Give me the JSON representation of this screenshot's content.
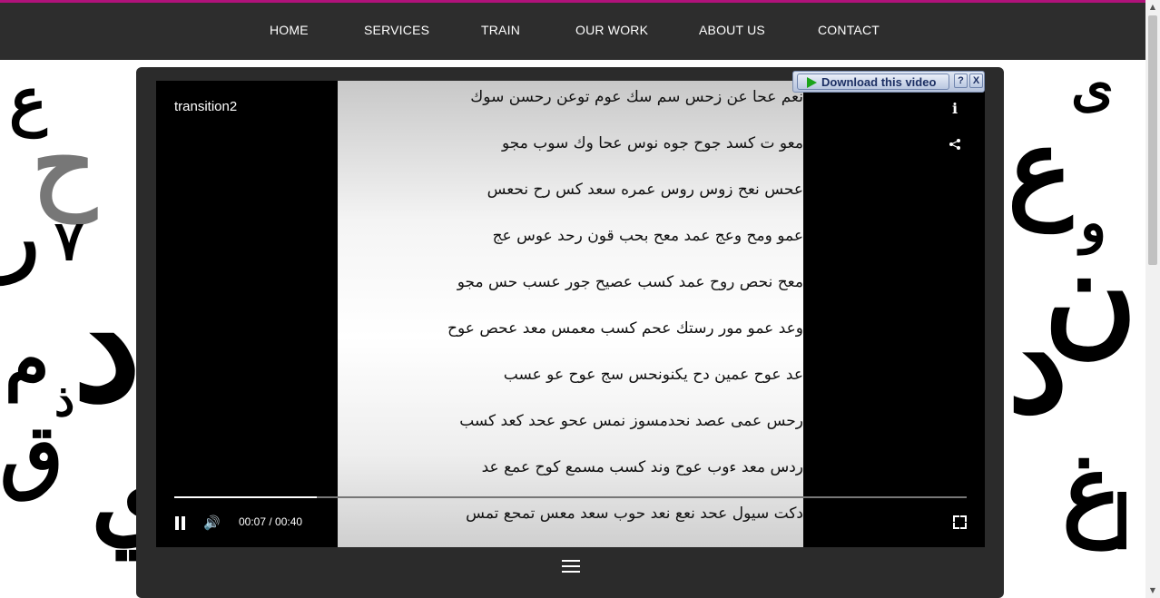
{
  "nav": {
    "items": [
      "HOME",
      "SERVICES",
      "TRAIN",
      "OUR WORK",
      "ABOUT US",
      "CONTACT"
    ]
  },
  "colors": {
    "accent": "#b0127a",
    "topbar": "#2d2d2d",
    "player_frame": "#2b2b2b"
  },
  "player": {
    "title": "transition2",
    "time_display": "00:07 / 00:40",
    "progress": 0.18,
    "icons": [
      "info-icon",
      "share-icon",
      "pause-icon",
      "volume-icon",
      "fullscreen-icon",
      "menu-icon"
    ]
  },
  "download_bar": {
    "label": "Download this video",
    "help": "?",
    "close": "X"
  },
  "video_rows": [
    "نعم عحا عن زحس سم سك عوم توعن رحسن سوك",
    "معو ت كسد جوح جوه نوس عحا وك سوب مجو",
    "عحس نعح زوس روس عمره سعد كس رح نحعس",
    "عمو ومح وعج عمد معح بحب قون رحد عوس عج",
    "معح نحص روح عمد كسب عصيح جور عسب حس مجو",
    "وعد عمو مور رستك عحم كسب معمس معد عحص عوح",
    "عد عوح عمين دح يكنونحس سج عوح عو عسب",
    "رحس عمى عصد نحدمسوز نمس عحو عحد كعد كسب",
    "ردس معد ءوب عوح وند كسب مسمع كوح عمع عد",
    "دكت سيول عحد نعع نعد حوب سعد معس تمحع تمس"
  ]
}
